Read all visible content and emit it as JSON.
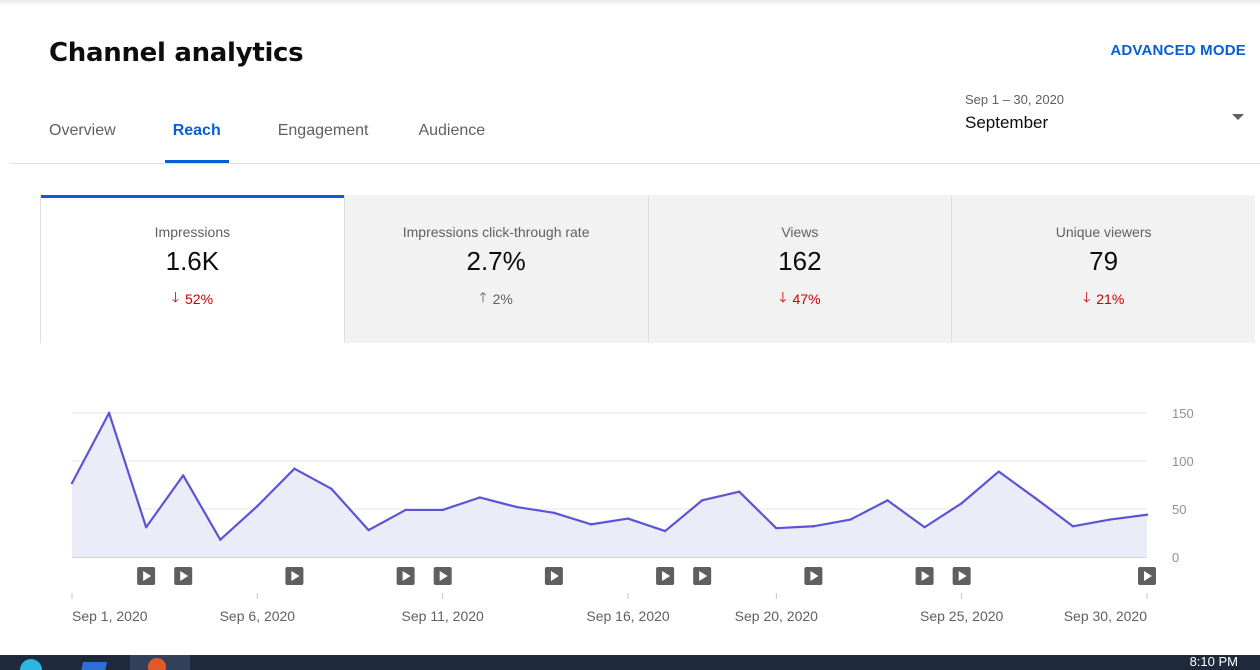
{
  "header": {
    "title": "Channel analytics",
    "advanced_mode_label": "ADVANCED MODE"
  },
  "tabs": [
    {
      "label": "Overview",
      "active": false
    },
    {
      "label": "Reach",
      "active": true
    },
    {
      "label": "Engagement",
      "active": false
    },
    {
      "label": "Audience",
      "active": false
    }
  ],
  "date_picker": {
    "range": "Sep 1 – 30, 2020",
    "label": "September"
  },
  "metrics": [
    {
      "title": "Impressions",
      "value": "1.6K",
      "change": "52%",
      "direction": "down",
      "selected": true
    },
    {
      "title": "Impressions click-through rate",
      "value": "2.7%",
      "change": "2%",
      "direction": "up",
      "selected": false
    },
    {
      "title": "Views",
      "value": "162",
      "change": "47%",
      "direction": "down",
      "selected": false
    },
    {
      "title": "Unique viewers",
      "value": "79",
      "change": "21%",
      "direction": "down",
      "selected": false
    }
  ],
  "icons": {
    "arrow_down": "arrow-down-icon",
    "arrow_up": "arrow-up-icon",
    "dropdown": "caret-down-icon",
    "video_marker": "play-icon"
  },
  "colors": {
    "accent": "#065fd4",
    "line": "#5b54d6",
    "area": "#ececf8",
    "negative": "#cc0000",
    "neutral": "#606060"
  },
  "chart_data": {
    "type": "area",
    "x": [
      "Sep 1",
      "Sep 2",
      "Sep 3",
      "Sep 4",
      "Sep 5",
      "Sep 6",
      "Sep 7",
      "Sep 8",
      "Sep 9",
      "Sep 10",
      "Sep 11",
      "Sep 12",
      "Sep 13",
      "Sep 14",
      "Sep 15",
      "Sep 16",
      "Sep 17",
      "Sep 18",
      "Sep 19",
      "Sep 20",
      "Sep 21",
      "Sep 22",
      "Sep 23",
      "Sep 24",
      "Sep 25",
      "Sep 26",
      "Sep 27",
      "Sep 28",
      "Sep 29",
      "Sep 30"
    ],
    "series": [
      {
        "values": [
          77,
          150,
          31,
          85,
          18,
          53,
          92,
          71,
          28,
          49,
          49,
          62,
          52,
          46,
          34,
          40,
          27,
          59,
          68,
          30,
          32,
          39,
          59,
          31,
          56,
          89,
          61,
          32,
          39,
          44
        ]
      }
    ],
    "ylim": [
      0,
      150
    ],
    "yticks": [
      "0",
      "50",
      "100",
      "150"
    ],
    "xtick_labels": [
      "Sep 1, 2020",
      "Sep 6, 2020",
      "Sep 11, 2020",
      "Sep 16, 2020",
      "Sep 20, 2020",
      "Sep 25, 2020",
      "Sep 30, 2020"
    ],
    "video_markers": [
      "Sep 3",
      "Sep 4",
      "Sep 7",
      "Sep 10",
      "Sep 11",
      "Sep 14",
      "Sep 17",
      "Sep 18",
      "Sep 21",
      "Sep 24",
      "Sep 25",
      "Sep 30"
    ],
    "grid": true
  },
  "taskbar": {
    "clock": "8:10 PM"
  }
}
